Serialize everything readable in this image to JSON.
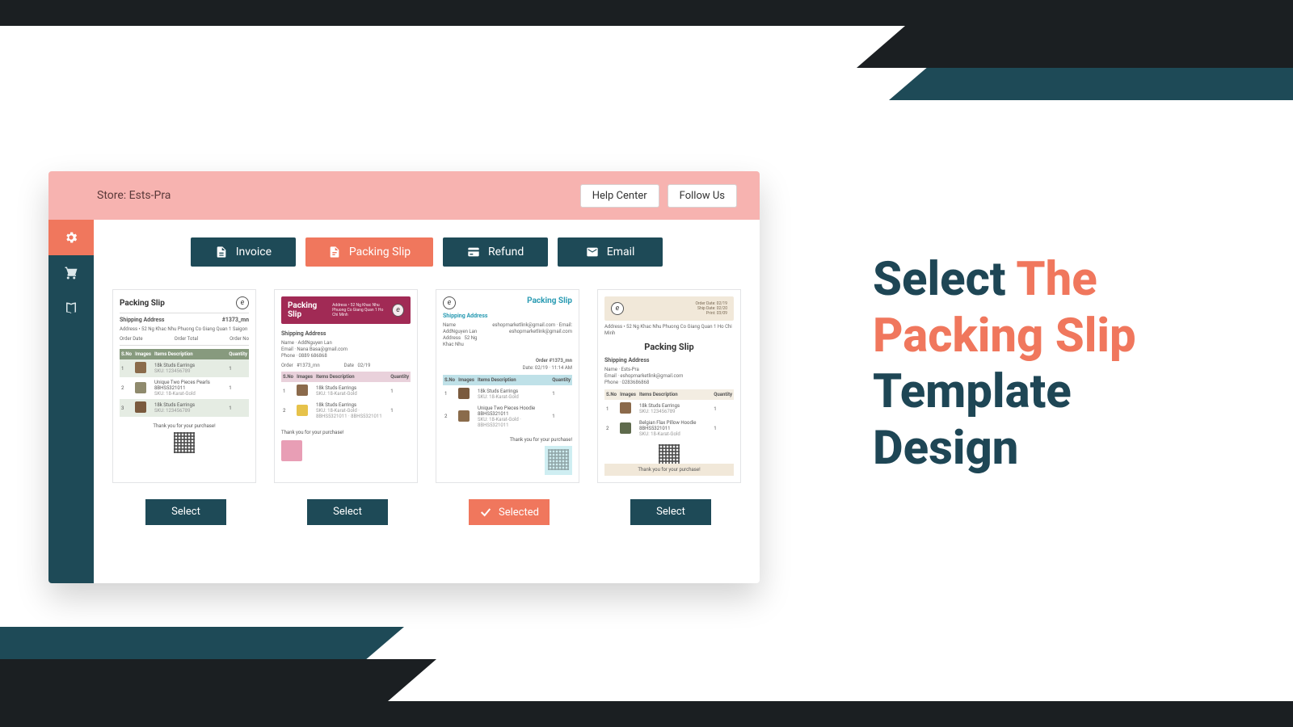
{
  "caption": {
    "pre": "Select ",
    "hl": "The Packing Slip",
    "post": " Template Design"
  },
  "header": {
    "store_label": "Store: Ests-Pra",
    "help_center": "Help Center",
    "follow_us": "Follow Us"
  },
  "sidebar": {
    "items": [
      {
        "name": "settings",
        "active": true
      },
      {
        "name": "cart",
        "active": false
      },
      {
        "name": "docs",
        "active": false
      }
    ]
  },
  "tabs": {
    "invoice": "Invoice",
    "packing_slip": "Packing Slip",
    "refund": "Refund",
    "email": "Email",
    "active": "packing_slip"
  },
  "templates": [
    {
      "id": "tpl1",
      "title": "Packing Slip",
      "shipping_heading": "Shipping Address",
      "order_ref": "#1373_mn",
      "address": "Address • 52 Ng Khac Nhu Phuong Co Giang Quan 1 Saigon",
      "footer": "Thank you for your purchase!",
      "cols": [
        "S.No",
        "Images",
        "Items Description",
        "Quantity"
      ],
      "rows": [
        {
          "n": "1",
          "desc": "18k Studs Earrings",
          "sku": "SKU: 123456789",
          "qty": "1",
          "sw": "#8a6b4b"
        },
        {
          "n": "2",
          "desc": "Unique Two Pieces Pearls 8BHS5321011",
          "sku": "SKU: 18-Karat-Gold",
          "qty": "1",
          "sw": "#8f8a6d"
        },
        {
          "n": "3",
          "desc": "18k Studs Earrings",
          "sku": "SKU: 123456789",
          "qty": "1",
          "sw": "#7a5a3e"
        }
      ]
    },
    {
      "id": "tpl2",
      "title": "Packing Slip",
      "shipping_heading": "Shipping Address",
      "address": "Address • 52 Ng Khac Nhu Phuong Co Giang Quan 1 Ho Chi Minh",
      "footer": "Thank you for your purchase!",
      "cols": [
        "S.No",
        "Images",
        "Items Description",
        "Quantity"
      ],
      "rows": [
        {
          "n": "1",
          "desc": "18k Studs Earrings",
          "sku": "SKU: 18-Karat-Gold",
          "qty": "1",
          "sw": "#8b6a4b"
        },
        {
          "n": "2",
          "desc": "18k Studs Earrings",
          "sku": "SKU: 18-Karat-Gold · 8BHS5321011 · 8BHS5321011",
          "qty": "1",
          "sw": "#e6c24a"
        }
      ]
    },
    {
      "id": "tpl3",
      "title": "Packing Slip",
      "shipping_heading": "Shipping Address",
      "sub_label": "eshopmarketlink@gmail.com · Email: eshopmarketlink@gmail.com",
      "footer": "Thank you for your purchase!",
      "cols": [
        "S.No",
        "Images",
        "Items Description",
        "Quantity"
      ],
      "rows": [
        {
          "n": "1",
          "desc": "18k Studs Earrings",
          "sku": "SKU: 18-Karat-Gold",
          "qty": "1",
          "sw": "#7a5a3e"
        },
        {
          "n": "2",
          "desc": "Unique Two Pieces Hoodie 8BHS5321011",
          "sku": "SKU: 18-Karat-Gold · 8BHS5321011",
          "qty": "1",
          "sw": "#8a6b4b"
        }
      ]
    },
    {
      "id": "tpl4",
      "title": "Packing Slip",
      "shipping_heading": "Shipping Address",
      "address": "Address • 52 Ng Khac Nhu Phuong Co Giang Quan 1 Ho Chi Minh",
      "footer": "Thank you for your purchase!",
      "cols": [
        "S.No",
        "Images",
        "Items Description",
        "Quantity"
      ],
      "rows": [
        {
          "n": "1",
          "desc": "18k Studs Earrings",
          "sku": "SKU: 123456789",
          "qty": "1",
          "sw": "#8b6a4b"
        },
        {
          "n": "2",
          "desc": "Belgian Flax Pillow Hoodie 8BHS5321011",
          "sku": "SKU: 18-Karat-Gold",
          "qty": "1",
          "sw": "#5e6a4c"
        }
      ]
    }
  ],
  "buttons": {
    "select": "Select",
    "selected": "Selected",
    "selected_index": 2
  }
}
